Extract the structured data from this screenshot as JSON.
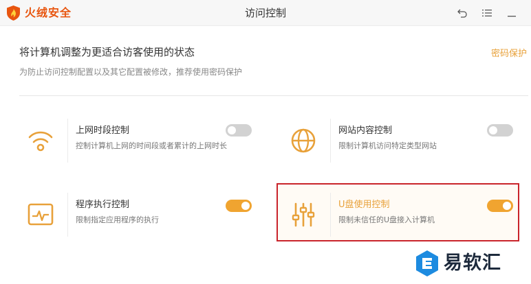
{
  "app": {
    "name": "火绒安全",
    "window_title": "访问控制"
  },
  "header": {
    "title": "将计算机调整为更适合访客使用的状态",
    "subtitle": "为防止访问控制配置以及其它配置被修改，推荐使用密码保护",
    "password_link": "密码保护"
  },
  "colors": {
    "accent": "#e8a13a",
    "toggle_on": "#f0a430",
    "toggle_off": "#d2d2d2",
    "highlight_border": "#c9232a",
    "brand": "#e8550f"
  },
  "cards": [
    {
      "title": "上网时段控制",
      "desc": "控制计算机上网的时间段或者累计的上网时长",
      "icon": "wifi-icon",
      "enabled": false
    },
    {
      "title": "网站内容控制",
      "desc": "限制计算机访问特定类型网站",
      "icon": "globe-icon",
      "enabled": false
    },
    {
      "title": "程序执行控制",
      "desc": "限制指定应用程序的执行",
      "icon": "monitor-pulse-icon",
      "enabled": true
    },
    {
      "title": "U盘使用控制",
      "desc": "限制未信任的U盘接入计算机",
      "icon": "sliders-icon",
      "enabled": true
    }
  ],
  "watermark": {
    "text": "易软汇"
  }
}
